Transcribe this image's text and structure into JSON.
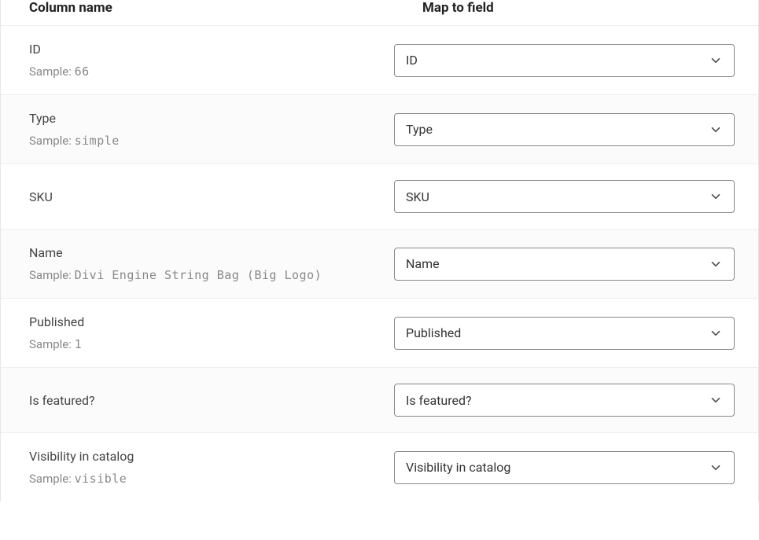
{
  "headers": {
    "column_name": "Column name",
    "map_to_field": "Map to field"
  },
  "sample_label": "Sample:",
  "rows": [
    {
      "name": "ID",
      "sample": "66",
      "selected": "ID"
    },
    {
      "name": "Type",
      "sample": "simple",
      "selected": "Type"
    },
    {
      "name": "SKU",
      "sample": "",
      "selected": "SKU"
    },
    {
      "name": "Name",
      "sample": "Divi Engine String Bag (Big Logo)",
      "selected": "Name"
    },
    {
      "name": "Published",
      "sample": "1",
      "selected": "Published"
    },
    {
      "name": "Is featured?",
      "sample": "",
      "selected": "Is featured?"
    },
    {
      "name": "Visibility in catalog",
      "sample": "visible",
      "selected": "Visibility in catalog"
    }
  ]
}
